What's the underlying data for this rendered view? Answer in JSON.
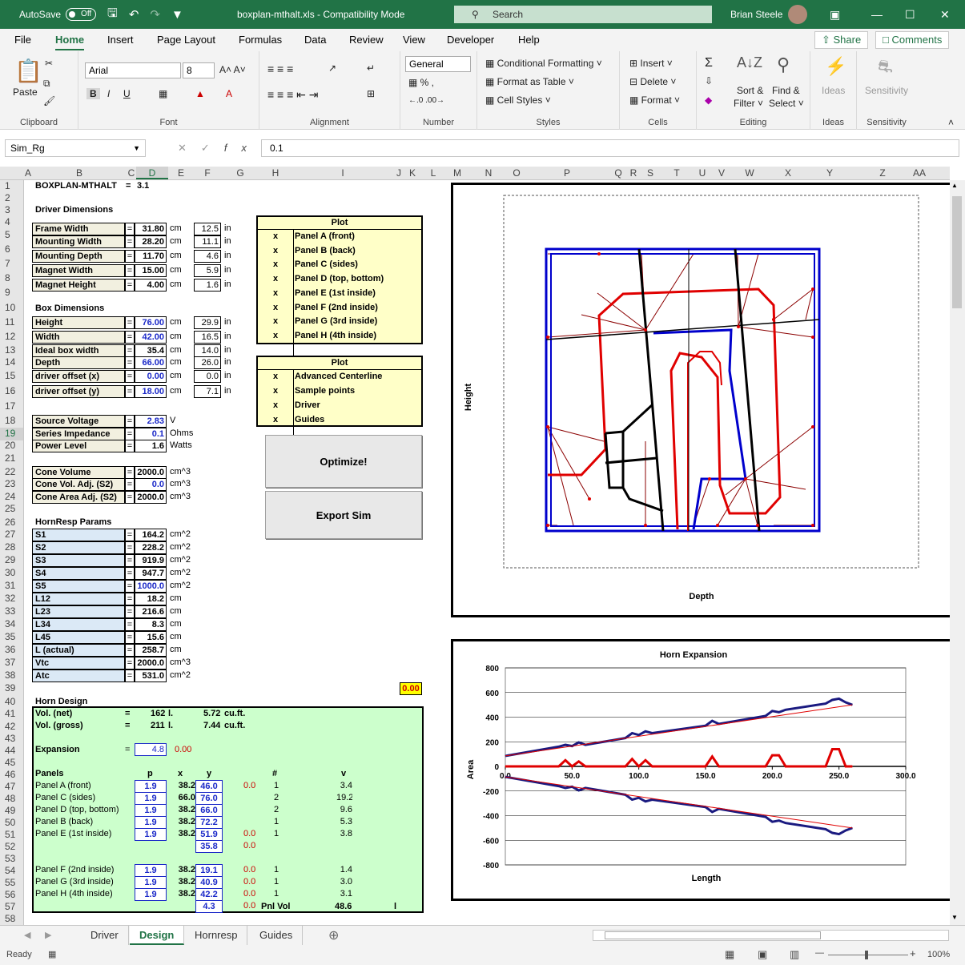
{
  "titlebar": {
    "autosave": "AutoSave",
    "autosave_state": "Off",
    "doc_title": "boxplan-mthalt.xls  -  Compatibility Mode",
    "search_placeholder": "Search",
    "user_name": "Brian Steele"
  },
  "tabs": [
    "File",
    "Home",
    "Insert",
    "Page Layout",
    "Formulas",
    "Data",
    "Review",
    "View",
    "Developer",
    "Help"
  ],
  "active_tab": "Home",
  "share": "Share",
  "comments": "Comments",
  "ribbon": {
    "clipboard": {
      "label": "Clipboard",
      "paste": "Paste"
    },
    "font": {
      "label": "Font",
      "name": "Arial",
      "size": "8"
    },
    "alignment": {
      "label": "Alignment"
    },
    "number": {
      "label": "Number",
      "format": "General"
    },
    "styles": {
      "label": "Styles",
      "cond": "Conditional Formatting",
      "table": "Format as Table",
      "cell": "Cell Styles"
    },
    "cells": {
      "label": "Cells",
      "insert": "Insert",
      "delete": "Delete",
      "format": "Format"
    },
    "editing": {
      "label": "Editing",
      "sort": "Sort &",
      "filter": "Filter",
      "find": "Find &",
      "select": "Select"
    },
    "ideas": {
      "label": "Ideas",
      "btn": "Ideas"
    },
    "sensitivity": {
      "label": "Sensitivity",
      "btn": "Sensitivity"
    }
  },
  "namebox": "Sim_Rg",
  "formula": "0.1",
  "columns": [
    "A",
    "B",
    "C",
    "D",
    "E",
    "F",
    "G",
    "H",
    "I",
    "J",
    "K",
    "L",
    "M",
    "N",
    "O",
    "P",
    "Q",
    "R",
    "S",
    "T",
    "U",
    "V",
    "W",
    "X",
    "Y",
    "Z",
    "AA"
  ],
  "sheet": {
    "title": "BOXPLAN-MTHALT",
    "title_eq": "=",
    "version": "3.1",
    "driver_hdr": "Driver Dimensions",
    "driver": [
      {
        "l": "Frame Width",
        "v": "31.80",
        "u": "cm",
        "i": "12.5",
        "iu": "in"
      },
      {
        "l": "Mounting Width",
        "v": "28.20",
        "u": "cm",
        "i": "11.1",
        "iu": "in"
      },
      {
        "l": "Mounting Depth",
        "v": "11.70",
        "u": "cm",
        "i": "4.6",
        "iu": "in"
      },
      {
        "l": "Magnet Width",
        "v": "15.00",
        "u": "cm",
        "i": "5.9",
        "iu": "in"
      },
      {
        "l": "Magnet Height",
        "v": "4.00",
        "u": "cm",
        "i": "1.6",
        "iu": "in"
      }
    ],
    "box_hdr": "Box Dimensions",
    "box": [
      {
        "l": "Height",
        "v": "76.00",
        "u": "cm",
        "i": "29.9",
        "iu": "in",
        "in": true
      },
      {
        "l": "Width",
        "v": "42.00",
        "u": "cm",
        "i": "16.5",
        "iu": "in",
        "in": true
      },
      {
        "l": "Ideal box width",
        "v": "35.4",
        "u": "cm",
        "i": "14.0",
        "iu": "in"
      },
      {
        "l": "Depth",
        "v": "66.00",
        "u": "cm",
        "i": "26.0",
        "iu": "in",
        "in": true
      },
      {
        "l": "driver offset (x)",
        "v": "0.00",
        "u": "cm",
        "i": "0.0",
        "iu": "in",
        "in": true
      },
      {
        "l": "driver offset (y)",
        "v": "18.00",
        "u": "cm",
        "i": "7.1",
        "iu": "in",
        "in": true
      }
    ],
    "power": [
      {
        "l": "Source Voltage",
        "v": "2.83",
        "u": "V",
        "in": true
      },
      {
        "l": "Series Impedance",
        "v": "0.1",
        "u": "Ohms",
        "in": true
      },
      {
        "l": "Power Level",
        "v": "1.6",
        "u": "Watts"
      }
    ],
    "cone": [
      {
        "l": "Cone Volume",
        "v": "2000.0",
        "u": "cm^3"
      },
      {
        "l": "Cone Vol. Adj. (S2)",
        "v": "0.0",
        "u": "cm^3",
        "in": true
      },
      {
        "l": "Cone Area Adj. (S2)",
        "v": "2000.0",
        "u": "cm^3"
      }
    ],
    "horn_hdr": "HornResp Params",
    "horn": [
      {
        "l": "S1",
        "v": "164.2",
        "u": "cm^2"
      },
      {
        "l": "S2",
        "v": "228.2",
        "u": "cm^2"
      },
      {
        "l": "S3",
        "v": "919.9",
        "u": "cm^2"
      },
      {
        "l": "S4",
        "v": "947.7",
        "u": "cm^2"
      },
      {
        "l": "S5",
        "v": "1000.0",
        "u": "cm^2",
        "in": true
      },
      {
        "l": "L12",
        "v": "18.2",
        "u": "cm"
      },
      {
        "l": "L23",
        "v": "216.6",
        "u": "cm"
      },
      {
        "l": "L34",
        "v": "8.3",
        "u": "cm"
      },
      {
        "l": "L45",
        "v": "15.6",
        "u": "cm"
      },
      {
        "l": "L (actual)",
        "v": "258.7",
        "u": "cm"
      },
      {
        "l": "Vtc",
        "v": "2000.0",
        "u": "cm^3"
      },
      {
        "l": "Atc",
        "v": "531.0",
        "u": "cm^2"
      }
    ],
    "yellow_val": "0.00",
    "plot1": {
      "title": "Plot",
      "items": [
        "Panel A (front)",
        "Panel B (back)",
        "Panel C (sides)",
        "Panel D (top, bottom)",
        "Panel E (1st inside)",
        "Panel F (2nd inside)",
        "Panel G (3rd inside)",
        "Panel H (4th inside)"
      ],
      "mark": "x"
    },
    "plot2": {
      "title": "Plot",
      "items": [
        "Advanced Centerline",
        "Sample points",
        "Driver",
        "Guides"
      ],
      "mark": "x"
    },
    "btn_optimize": "Optimize!",
    "btn_export": "Export Sim",
    "horn_design": {
      "hdr": "Horn Design",
      "vol_net": {
        "l": "Vol. (net)",
        "eq": "=",
        "v": "162",
        "u": "l.",
        "v2": "5.72",
        "u2": "cu.ft."
      },
      "vol_gross": {
        "l": "Vol. (gross)",
        "eq": "=",
        "v": "211",
        "u": "l.",
        "v2": "7.44",
        "u2": "cu.ft."
      },
      "expansion": {
        "l": "Expansion",
        "eq": "=",
        "v": "4.8",
        "r": "0.00"
      },
      "cols": {
        "panels": "Panels",
        "p": "p",
        "x": "x",
        "y": "y",
        "n": "#",
        "v": "v"
      },
      "rows": [
        {
          "l": "Panel A (front)",
          "p": "1.9",
          "x": "38.2",
          "y": "46.0",
          "r": "0.0",
          "n": "1",
          "v": "3.4"
        },
        {
          "l": "Panel C (sides)",
          "p": "1.9",
          "x": "66.0",
          "y": "76.0",
          "r": "",
          "n": "2",
          "v": "19.2"
        },
        {
          "l": "Panel D (top, bottom)",
          "p": "1.9",
          "x": "38.2",
          "y": "66.0",
          "r": "",
          "n": "2",
          "v": "9.6"
        },
        {
          "l": "Panel B (back)",
          "p": "1.9",
          "x": "38.2",
          "y": "72.2",
          "r": "",
          "n": "1",
          "v": "5.3"
        },
        {
          "l": "Panel E (1st inside)",
          "p": "1.9",
          "x": "38.2",
          "y": "51.9",
          "r": "0.0",
          "n": "1",
          "v": "3.8"
        },
        {
          "l": "",
          "p": "",
          "x": "",
          "y": "35.8",
          "r": "0.0",
          "n": "",
          "v": ""
        },
        {
          "l": "",
          "p": "",
          "x": "",
          "y": "",
          "r": "",
          "n": "",
          "v": ""
        },
        {
          "l": "Panel F (2nd inside)",
          "p": "1.9",
          "x": "38.2",
          "y": "19.1",
          "r": "0.0",
          "n": "1",
          "v": "1.4"
        },
        {
          "l": "Panel G (3rd inside)",
          "p": "1.9",
          "x": "38.2",
          "y": "40.9",
          "r": "0.0",
          "n": "1",
          "v": "3.0"
        },
        {
          "l": "Panel H (4th inside)",
          "p": "1.9",
          "x": "38.2",
          "y": "42.2",
          "r": "0.0",
          "n": "1",
          "v": "3.1"
        },
        {
          "l": "",
          "p": "",
          "x": "",
          "y": "4.3",
          "r": "0.0",
          "n": "",
          "v": ""
        }
      ],
      "pnl_vol": {
        "l": "Pnl Vol",
        "v": "48.6",
        "u": "l"
      }
    }
  },
  "chart_data": [
    {
      "type": "diagram",
      "xlabel": "Depth",
      "ylabel": "Height"
    },
    {
      "type": "line",
      "title": "Horn Expansion",
      "xlabel": "Length",
      "ylabel": "Area",
      "xlim": [
        0,
        300
      ],
      "ylim": [
        -800,
        800
      ],
      "xticks": [
        "0.0",
        "50.0",
        "100.0",
        "150.0",
        "200.0",
        "250.0",
        "300.0"
      ],
      "yticks": [
        "800",
        "600",
        "400",
        "200",
        "0",
        "-200",
        "-400",
        "-600",
        "-800"
      ],
      "series": [
        {
          "x": [
            0,
            40,
            45,
            50,
            55,
            60,
            90,
            95,
            100,
            105,
            110,
            150,
            155,
            160,
            195,
            200,
            205,
            210,
            240,
            245,
            250,
            255,
            260
          ],
          "values": [
            85,
            160,
            175,
            165,
            195,
            175,
            230,
            270,
            255,
            285,
            270,
            330,
            370,
            345,
            410,
            450,
            440,
            460,
            510,
            540,
            550,
            520,
            500
          ]
        },
        {
          "x": [
            0,
            40,
            45,
            50,
            55,
            60,
            90,
            95,
            100,
            105,
            110,
            150,
            155,
            160,
            195,
            200,
            205,
            210,
            240,
            245,
            250,
            255,
            260
          ],
          "values": [
            0,
            0,
            50,
            0,
            40,
            0,
            0,
            60,
            0,
            50,
            0,
            0,
            80,
            0,
            0,
            90,
            90,
            0,
            0,
            140,
            140,
            0,
            0
          ]
        },
        {
          "x": [
            0,
            40,
            45,
            50,
            55,
            60,
            90,
            95,
            100,
            105,
            110,
            150,
            155,
            160,
            195,
            200,
            205,
            210,
            240,
            245,
            250,
            255,
            260
          ],
          "values": [
            -85,
            -160,
            -175,
            -165,
            -195,
            -175,
            -230,
            -270,
            -255,
            -285,
            -270,
            -330,
            -370,
            -345,
            -410,
            -450,
            -440,
            -460,
            -510,
            -540,
            -550,
            -520,
            -500
          ]
        }
      ]
    }
  ],
  "sheet_tabs": [
    "Driver",
    "Design",
    "Hornresp",
    "Guides"
  ],
  "active_sheet": "Design",
  "status": {
    "ready": "Ready",
    "zoom": "100%"
  }
}
